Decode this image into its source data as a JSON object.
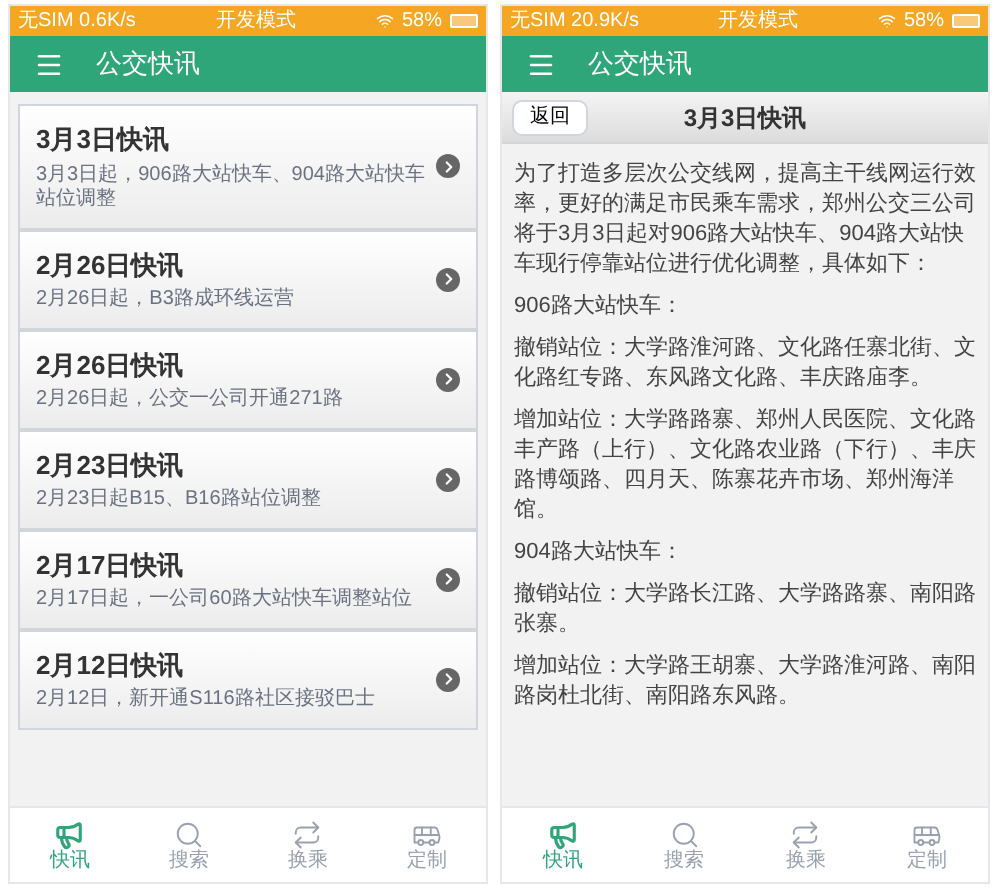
{
  "left": {
    "status_bar": {
      "carrier": "无SIM 0.6K/s",
      "mode": "开发模式",
      "battery": "58%"
    },
    "header": {
      "title": "公交快讯"
    },
    "news": [
      {
        "title": "3月3日快讯",
        "summary": "3月3日起，906路大站快车、904路大站快车站位调整"
      },
      {
        "title": "2月26日快讯",
        "summary": "2月26日起，B3路成环线运营"
      },
      {
        "title": "2月26日快讯",
        "summary": "2月26日起，公交一公司开通271路"
      },
      {
        "title": "2月23日快讯",
        "summary": "2月23日起B15、B16路站位调整"
      },
      {
        "title": "2月17日快讯",
        "summary": "2月17日起，一公司60路大站快车调整站位"
      },
      {
        "title": "2月12日快讯",
        "summary": "2月12日，新开通S116路社区接驳巴士"
      }
    ],
    "tab_bar": [
      {
        "kind": "news",
        "label": "快讯",
        "selected": true
      },
      {
        "kind": "search",
        "label": "搜索",
        "selected": false
      },
      {
        "kind": "transfer",
        "label": "换乘",
        "selected": false
      },
      {
        "kind": "custom",
        "label": "定制",
        "selected": false
      }
    ]
  },
  "right": {
    "status_bar": {
      "carrier": "无SIM 20.9K/s",
      "mode": "开发模式",
      "battery": "58%"
    },
    "header": {
      "title": "公交快讯"
    },
    "article": {
      "back_button": "返回",
      "title": "3月3日快讯",
      "paragraphs": [
        "为了打造多层次公交线网，提高主干线网运行效率，更好的满足市民乘车需求，郑州公交三公司将于3月3日起对906路大站快车、904路大站快车现行停靠站位进行优化调整，具体如下：",
        "906路大站快车：",
        "撤销站位：大学路淮河路、文化路任寨北街、文化路红专路、东风路文化路、丰庆路庙李。",
        "增加站位：大学路路寨、郑州人民医院、文化路丰产路（上行）、文化路农业路（下行）、丰庆路博颂路、四月天、陈寨花卉市场、郑州海洋馆。",
        "904路大站快车：",
        "撤销站位：大学路长江路、大学路路寨、南阳路张寨。",
        "增加站位：大学路王胡寨、大学路淮河路、南阳路岗杜北街、南阳路东风路。"
      ]
    },
    "tab_bar": [
      {
        "kind": "news",
        "label": "快讯",
        "selected": true
      },
      {
        "kind": "search",
        "label": "搜索",
        "selected": false
      },
      {
        "kind": "transfer",
        "label": "换乘",
        "selected": false
      },
      {
        "kind": "custom",
        "label": "定制",
        "selected": false
      }
    ]
  }
}
